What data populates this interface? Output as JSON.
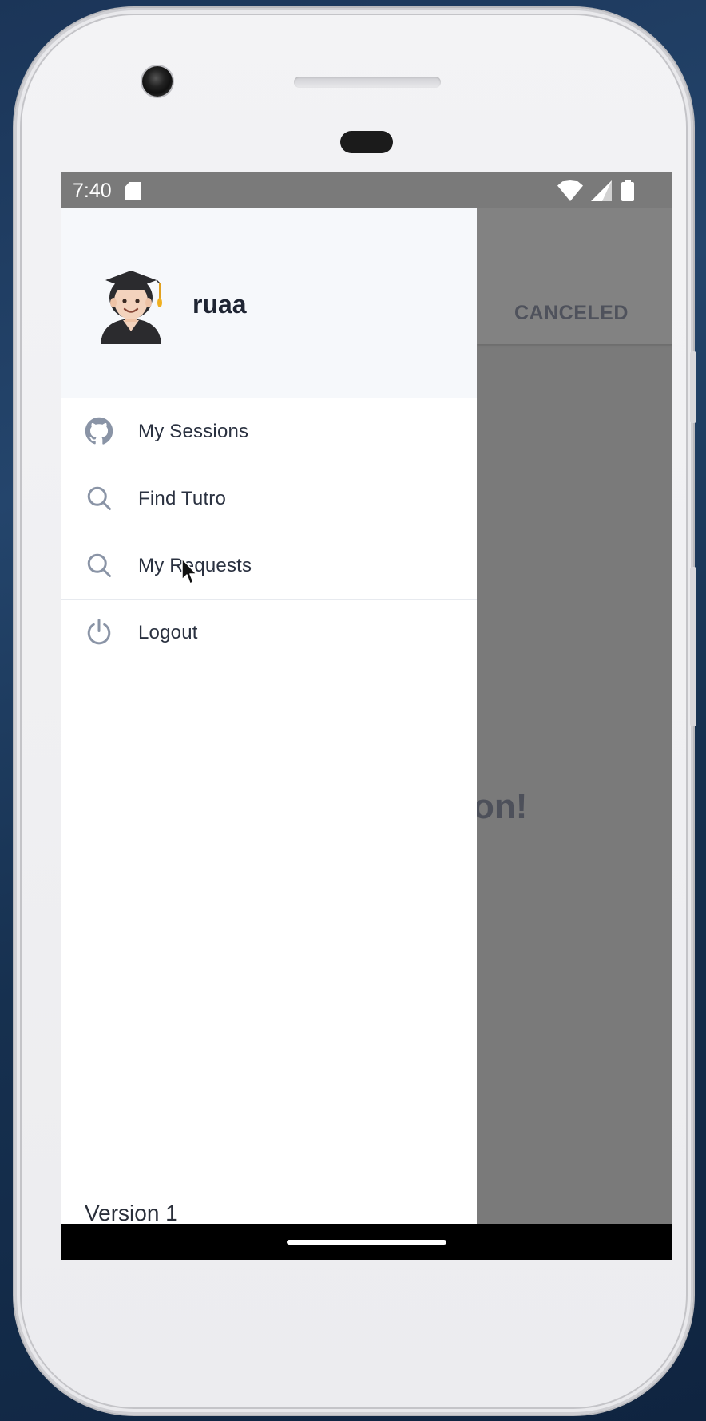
{
  "status_bar": {
    "time": "7:40"
  },
  "drawer": {
    "user": {
      "name": "ruaa",
      "avatar_icon": "student-avatar-icon"
    },
    "items": [
      {
        "label": "My Sessions",
        "icon": "github-icon"
      },
      {
        "label": "Find Tutro",
        "icon": "search-icon"
      },
      {
        "label": "My Requests",
        "icon": "search-icon"
      },
      {
        "label": "Logout",
        "icon": "power-icon"
      }
    ],
    "footer": {
      "version": "Version 1"
    }
  },
  "background_screen": {
    "tab_label": "CANCELED",
    "heading_partial": "on!"
  },
  "colors": {
    "scrim": "#7a7a7a",
    "drawer_header_bg": "#f6f8fb",
    "text_primary": "#1f2533",
    "icon_gray": "#8a94a6"
  }
}
